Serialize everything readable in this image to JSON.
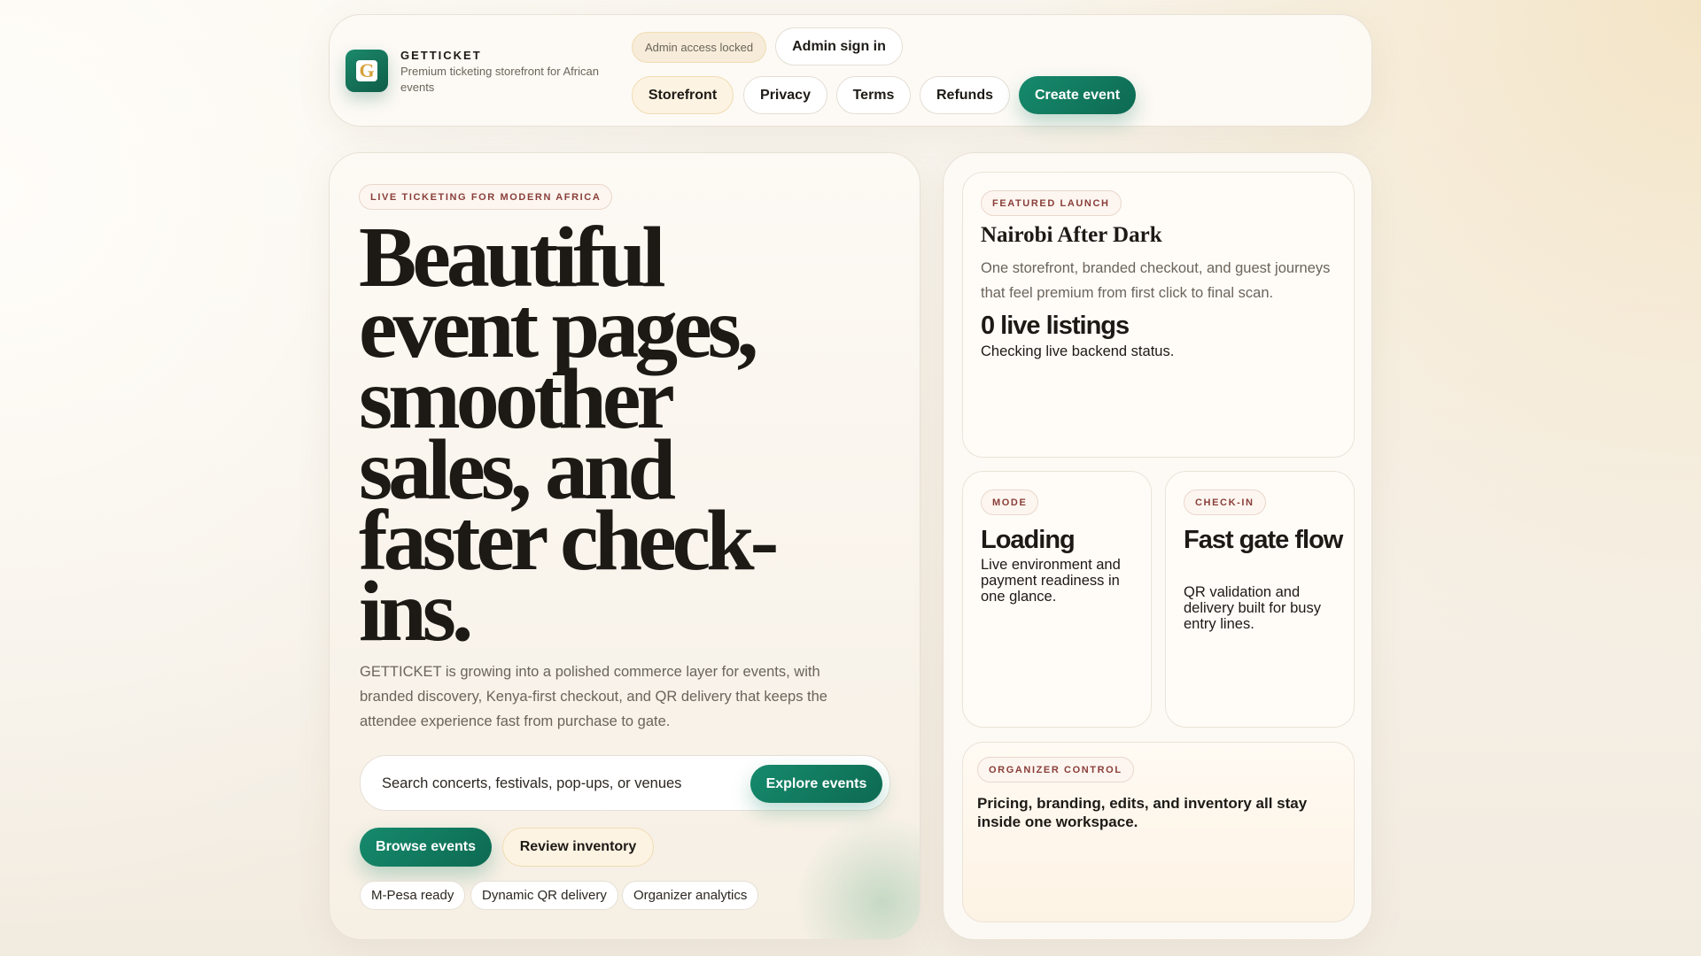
{
  "header": {
    "brand": "GETTICKET",
    "tagline": "Premium ticketing storefront for African events",
    "admin_status": "Admin access locked",
    "admin_signin": "Admin sign in",
    "nav": [
      "Storefront",
      "Privacy",
      "Terms",
      "Refunds"
    ],
    "create_event": "Create event"
  },
  "hero": {
    "badge": "LIVE TICKETING FOR MODERN AFRICA",
    "headline": "Beautiful event pages, smoother sales, and faster check-ins.",
    "description": "GETTICKET is growing into a polished commerce layer for events, with branded discovery, Kenya-first checkout, and QR delivery that keeps the attendee experience fast from purchase to gate.",
    "search_placeholder": "Search concerts, festivals, pop-ups, or venues",
    "explore": "Explore events",
    "browse": "Browse events",
    "review": "Review inventory",
    "chips": [
      "M-Pesa ready",
      "Dynamic QR delivery",
      "Organizer analytics"
    ]
  },
  "featured": {
    "badge": "FEATURED LAUNCH",
    "title": "Nairobi After Dark",
    "description": "One storefront, branded checkout, and guest journeys that feel premium from first click to final scan.",
    "listings": "0 live listings",
    "status": "Checking live backend status."
  },
  "mode": {
    "badge": "MODE",
    "title": "Loading",
    "text": "Live environment and payment readiness in one glance."
  },
  "checkin": {
    "badge": "CHECK-IN",
    "title": "Fast gate flow",
    "text": "QR validation and delivery built for busy entry lines."
  },
  "organizer": {
    "badge": "ORGANIZER CONTROL",
    "text": "Pricing, branding, edits, and inventory all stay inside one workspace."
  }
}
